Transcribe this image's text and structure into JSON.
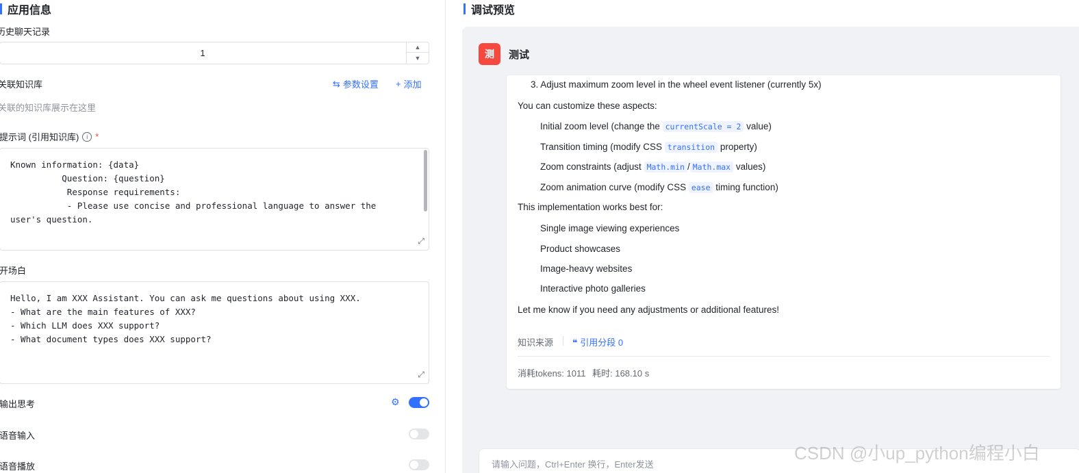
{
  "left": {
    "section_title": "应用信息",
    "history": {
      "label": "历史聊天记录",
      "value": "1"
    },
    "knowledge": {
      "label": "关联知识库",
      "settings_link": "参数设置",
      "add_link": "添加",
      "placeholder": "关联的知识库展示在这里"
    },
    "prompt": {
      "label": "提示词 (引用知识库)",
      "required": "*",
      "content": "Known information: {data}\n          Question: {question}\n           Response requirements:\n           - Please use concise and professional language to answer the\nuser's question."
    },
    "opening": {
      "label": "开场白",
      "content": "Hello, I am XXX Assistant. You can ask me questions about using XXX.\n- What are the main features of XXX?\n- Which LLM does XXX support?\n- What document types does XXX support?"
    },
    "output_thinking": {
      "label": "输出思考",
      "enabled": true
    },
    "voice_input": {
      "label": "语音输入",
      "enabled": false
    },
    "voice_playback": {
      "label": "语音播放",
      "enabled": false
    }
  },
  "right": {
    "section_title": "调试预览",
    "avatar_char": "测",
    "app_name": "测试",
    "answer": {
      "item3": "3. Adjust maximum zoom level in the wheel event listener (currently 5x)",
      "customize_intro": "You can customize these aspects:",
      "c1_before": "Initial zoom level (change the ",
      "c1_code": "currentScale = 2",
      "c1_after": " value)",
      "c2_before": "Transition timing (modify CSS ",
      "c2_code": "transition",
      "c2_after": " property)",
      "c3_before": "Zoom constraints (adjust ",
      "c3_code1": "Math.min",
      "c3_sep": "/",
      "c3_code2": "Math.max",
      "c3_after": " values)",
      "c4_before": "Zoom animation curve (modify CSS ",
      "c4_code": "ease",
      "c4_after": " timing function)",
      "best_intro": "This implementation works best for:",
      "best_items": [
        "Single image viewing experiences",
        "Product showcases",
        "Image-heavy websites",
        "Interactive photo galleries"
      ],
      "closing": "Let me know if you need any adjustments or additional features!"
    },
    "source_label": "知识来源",
    "cite_label": "引用分段 0",
    "tokens_text": "消耗tokens: 1011",
    "time_text": "耗时: 168.10 s",
    "input_placeholder": "请输入问题，Ctrl+Enter 换行，Enter发送"
  },
  "watermark": "CSDN @小up_python编程小白",
  "colors": {
    "accent": "#3370ff",
    "avatar": "#f5483f",
    "chat_bg": "#f0f2f5"
  }
}
